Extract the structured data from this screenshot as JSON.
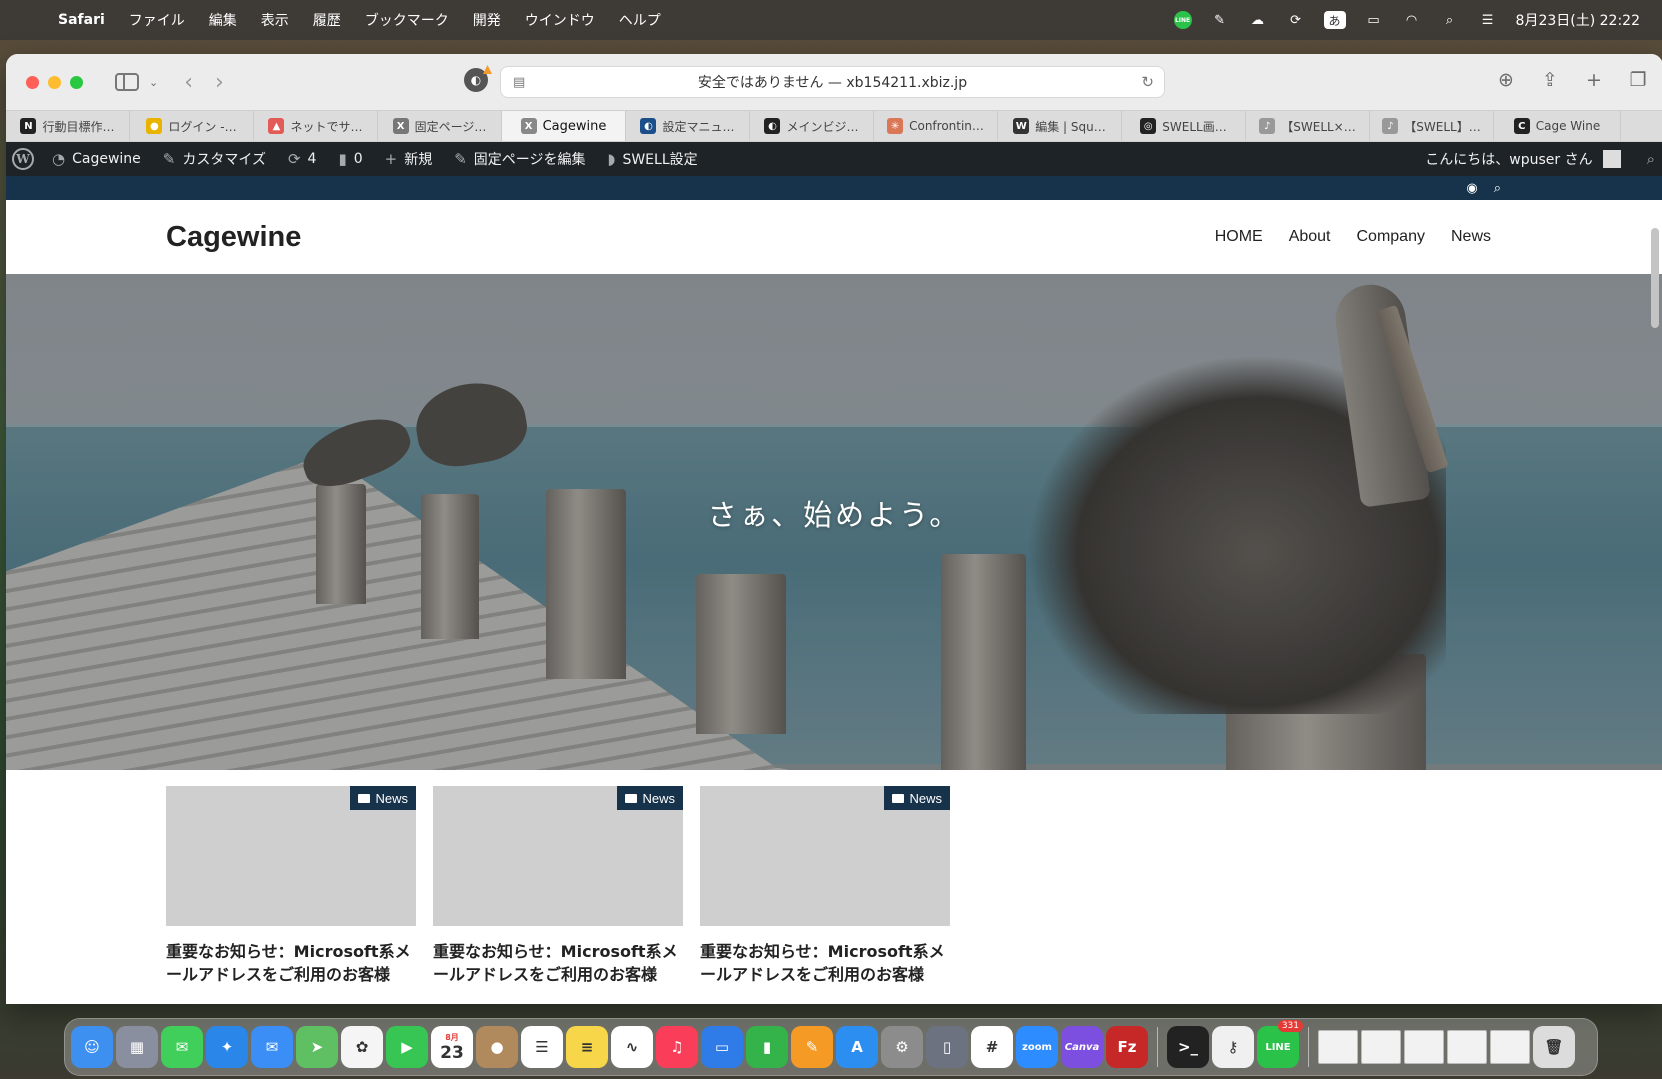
{
  "menubar": {
    "app": "Safari",
    "items": [
      "ファイル",
      "編集",
      "表示",
      "履歴",
      "ブックマーク",
      "開発",
      "ウインドウ",
      "ヘルプ"
    ],
    "status_icons": [
      "line-icon",
      "pen-icon",
      "cloud-icon",
      "sync-icon",
      "input-method-icon",
      "battery-icon",
      "wifi-icon",
      "search-icon",
      "control-center-icon"
    ],
    "ime_label": "あ",
    "line_label": "LINE",
    "clock": "8月23日(土) 22:22"
  },
  "browser": {
    "address": "安全ではありません — xb154211.xbiz.jp",
    "tabs": [
      {
        "label": "行動目標作…",
        "fav_text": "N",
        "fav_color": "#222"
      },
      {
        "label": "ログイン -…",
        "fav_text": "●",
        "fav_color": "#e8b400"
      },
      {
        "label": "ネットでサ…",
        "fav_text": "▲",
        "fav_color": "#e35b57"
      },
      {
        "label": "固定ページ…",
        "fav_text": "X",
        "fav_color": "#777"
      },
      {
        "label": "Cagewine",
        "fav_text": "X",
        "fav_color": "#888"
      },
      {
        "label": "設定マニュ…",
        "fav_text": "◐",
        "fav_color": "#1c4f8a"
      },
      {
        "label": "メインビジ…",
        "fav_text": "◐",
        "fav_color": "#222"
      },
      {
        "label": "Confrontin…",
        "fav_text": "✳",
        "fav_color": "#d97757"
      },
      {
        "label": "編集 | Squ…",
        "fav_text": "W",
        "fav_color": "#333"
      },
      {
        "label": "SWELL画…",
        "fav_text": "◎",
        "fav_color": "#222"
      },
      {
        "label": "【SWELL×…",
        "fav_text": "♪",
        "fav_color": "#999"
      },
      {
        "label": "【SWELL】…",
        "fav_text": "♪",
        "fav_color": "#999"
      },
      {
        "label": "Cage Wine",
        "fav_text": "C",
        "fav_color": "#222"
      }
    ],
    "active_tab_index": 4
  },
  "adminbar": {
    "site": "Cagewine",
    "customize": "カスタマイズ",
    "updates": "4",
    "comments": "0",
    "new": "新規",
    "edit_page": "固定ページを編集",
    "swell": "SWELL設定",
    "greeting": "こんにちは、wpuser さん"
  },
  "site": {
    "logo": "Cagewine",
    "nav": [
      "HOME",
      "About",
      "Company",
      "News"
    ],
    "hero_text": "さぁ、始めよう。",
    "accent": "#17334b",
    "posts": [
      {
        "category": "News",
        "title": "重要なお知らせ：Microsoft系メールアドレスをご利用のお客様"
      },
      {
        "category": "News",
        "title": "重要なお知らせ：Microsoft系メールアドレスをご利用のお客様"
      },
      {
        "category": "News",
        "title": "重要なお知らせ：Microsoft系メールアドレスをご利用のお客様"
      }
    ]
  },
  "dock": {
    "calendar_month": "8月",
    "calendar_day": "23",
    "zoom_label": "zoom",
    "canva_label": "Canva",
    "line_badge": "331",
    "apps": [
      "finder-icon",
      "launchpad-icon",
      "messages-icon",
      "safari-icon",
      "mail-icon",
      "maps-icon",
      "photos-icon",
      "facetime-icon",
      "calendar-icon",
      "contacts-icon",
      "reminders-icon",
      "notes-icon",
      "freeform-icon",
      "music-icon",
      "keynote-icon",
      "numbers-icon",
      "pages-icon",
      "app-store-icon",
      "system-settings-icon",
      "iphone-mirroring-icon",
      "slack-icon",
      "zoom-icon",
      "canva-icon",
      "filezilla-icon",
      "terminal-icon",
      "key-icon",
      "line-icon",
      "trash-icon"
    ]
  }
}
